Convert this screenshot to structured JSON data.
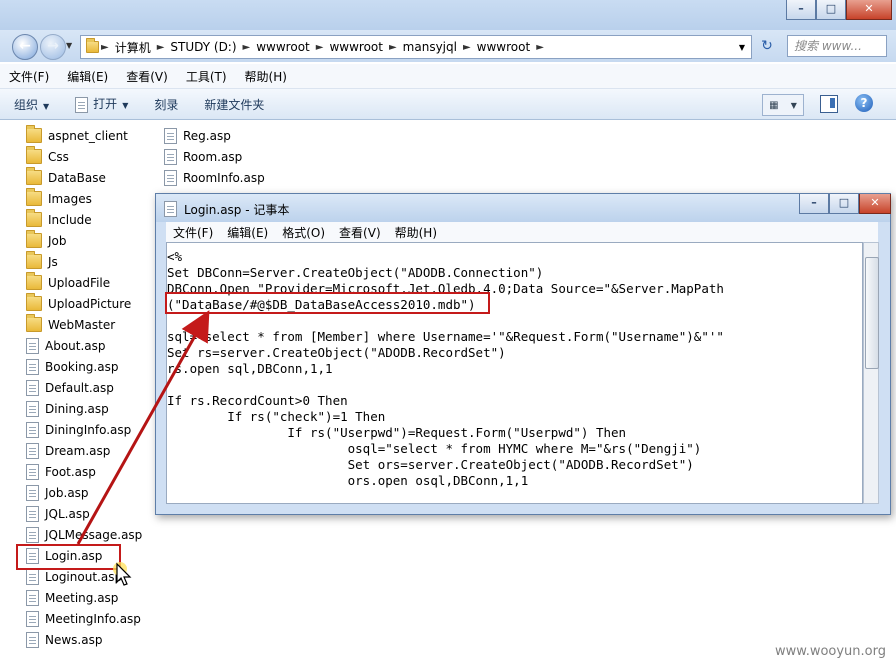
{
  "explorer": {
    "breadcrumbs": [
      "计算机",
      "STUDY (D:)",
      "wwwroot",
      "wwwroot",
      "mansyjql",
      "wwwroot"
    ],
    "search_placeholder": "搜索 www...",
    "menu": [
      "文件(F)",
      "编辑(E)",
      "查看(V)",
      "工具(T)",
      "帮助(H)"
    ],
    "toolbar": {
      "organize": "组织",
      "open": "打开",
      "burn": "刻录",
      "new_folder": "新建文件夹"
    },
    "window_buttons": {
      "min": "–",
      "max": "□",
      "close": "✕"
    }
  },
  "left_items": [
    {
      "name": "aspnet_client",
      "type": "folder"
    },
    {
      "name": "Css",
      "type": "folder"
    },
    {
      "name": "DataBase",
      "type": "folder"
    },
    {
      "name": "Images",
      "type": "folder"
    },
    {
      "name": "Include",
      "type": "folder"
    },
    {
      "name": "Job",
      "type": "folder"
    },
    {
      "name": "Js",
      "type": "folder"
    },
    {
      "name": "UploadFile",
      "type": "folder"
    },
    {
      "name": "UploadPicture",
      "type": "folder"
    },
    {
      "name": "WebMaster",
      "type": "folder"
    },
    {
      "name": "About.asp",
      "type": "file"
    },
    {
      "name": "Booking.asp",
      "type": "file"
    },
    {
      "name": "Default.asp",
      "type": "file"
    },
    {
      "name": "Dining.asp",
      "type": "file"
    },
    {
      "name": "DiningInfo.asp",
      "type": "file"
    },
    {
      "name": "Dream.asp",
      "type": "file"
    },
    {
      "name": "Foot.asp",
      "type": "file"
    },
    {
      "name": "Job.asp",
      "type": "file"
    },
    {
      "name": "JQL.asp",
      "type": "file"
    },
    {
      "name": "JQLMessage.asp",
      "type": "file"
    },
    {
      "name": "Login.asp",
      "type": "file"
    },
    {
      "name": "Loginout.asp",
      "type": "file"
    },
    {
      "name": "Meeting.asp",
      "type": "file"
    },
    {
      "name": "MeetingInfo.asp",
      "type": "file"
    },
    {
      "name": "News.asp",
      "type": "file"
    }
  ],
  "right_items": [
    {
      "name": "Reg.asp",
      "type": "file"
    },
    {
      "name": "Room.asp",
      "type": "file"
    },
    {
      "name": "RoomInfo.asp",
      "type": "file"
    }
  ],
  "notepad": {
    "title": "Login.asp - 记事本",
    "menu": [
      "文件(F)",
      "编辑(E)",
      "格式(O)",
      "查看(V)",
      "帮助(H)"
    ],
    "lines": [
      "<%",
      "Set DBConn=Server.CreateObject(\"ADODB.Connection\")",
      "DBConn.Open \"Provider=Microsoft.Jet.Oledb.4.0;Data Source=\"&Server.MapPath",
      "(\"DataBase/#@$DB_DataBaseAccess2010.mdb\")",
      "",
      "sql=\"select * from [Member] where Username='\"&Request.Form(\"Username\")&\"'\"",
      "Set rs=server.CreateObject(\"ADODB.RecordSet\")",
      "rs.open sql,DBConn,1,1",
      "",
      "If rs.RecordCount>0 Then",
      "        If rs(\"check\")=1 Then",
      "                If rs(\"Userpwd\")=Request.Form(\"Userpwd\") Then",
      "                        osql=\"select * from HYMC where M=\"&rs(\"Dengji\")",
      "                        Set ors=server.CreateObject(\"ADODB.RecordSet\")",
      "                        ors.open osql,DBConn,1,1",
      ""
    ]
  },
  "watermark": "www.wooyun.org"
}
